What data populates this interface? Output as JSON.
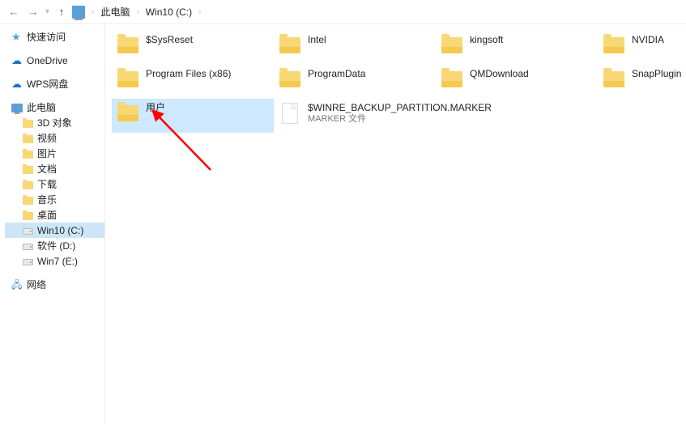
{
  "breadcrumb": {
    "root": "此电脑",
    "drive": "Win10 (C:)"
  },
  "sidebar": {
    "quick_access": {
      "label": "快速访问"
    },
    "onedrive": {
      "label": "OneDrive"
    },
    "wps": {
      "label": "WPS网盘"
    },
    "this_pc": {
      "label": "此电脑"
    },
    "pc_children": [
      {
        "key": "3d",
        "label": "3D 对象"
      },
      {
        "key": "videos",
        "label": "视频"
      },
      {
        "key": "pictures",
        "label": "图片"
      },
      {
        "key": "documents",
        "label": "文档"
      },
      {
        "key": "downloads",
        "label": "下载"
      },
      {
        "key": "music",
        "label": "音乐"
      },
      {
        "key": "desktop",
        "label": "桌面"
      },
      {
        "key": "drive_c",
        "label": "Win10 (C:)",
        "selected": true,
        "type": "drive"
      },
      {
        "key": "drive_d",
        "label": "软件 (D:)",
        "type": "drive"
      },
      {
        "key": "drive_e",
        "label": "Win7 (E:)",
        "type": "drive"
      }
    ],
    "network": {
      "label": "网络"
    }
  },
  "items": [
    {
      "name": "$SysReset",
      "type": "folder"
    },
    {
      "name": "Intel",
      "type": "folder"
    },
    {
      "name": "kingsoft",
      "type": "folder"
    },
    {
      "name": "NVIDIA",
      "type": "folder"
    },
    {
      "name": "Program Files (x86)",
      "type": "folder"
    },
    {
      "name": "ProgramData",
      "type": "folder"
    },
    {
      "name": "QMDownload",
      "type": "folder"
    },
    {
      "name": "SnapPlugin",
      "type": "folder"
    },
    {
      "name": "用户",
      "type": "folder",
      "selected": true
    },
    {
      "name": "$WINRE_BACKUP_PARTITION.MARKER",
      "sub": "MARKER 文件",
      "type": "file"
    }
  ]
}
